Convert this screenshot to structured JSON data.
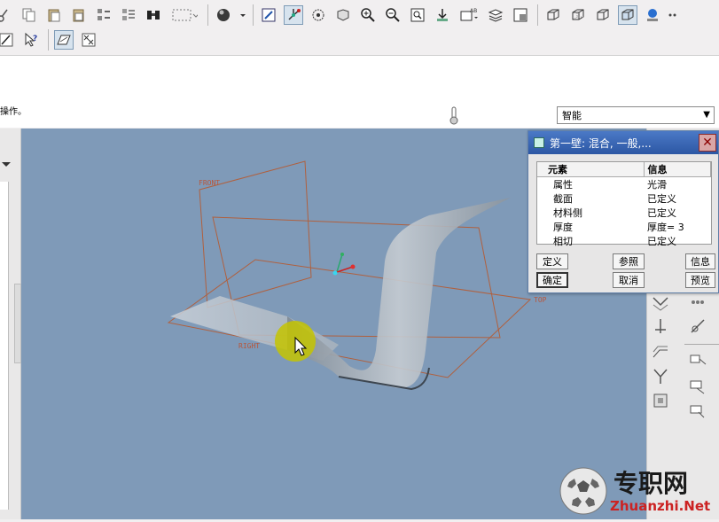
{
  "toolbar": {
    "row1": [
      "cut-icon",
      "copy-icon",
      "paste-icon",
      "paste-special-icon",
      "regenerate-icon",
      "regen-manager-icon",
      "find-icon",
      "select-box-icon",
      "shading-sphere-icon",
      "orient-icon",
      "spin-center-icon",
      "datum-display-icon",
      "redraw-icon",
      "zoom-in-icon",
      "zoom-out-icon",
      "refit-icon",
      "reorient-icon",
      "saved-views-icon",
      "layers-icon",
      "view-manager-icon",
      "wireframe-icon",
      "hidden-line-icon",
      "no-hidden-icon",
      "shaded-icon",
      "model-tree-icon",
      "more-icon"
    ],
    "row2": [
      "sketch-icon",
      "context-help-icon",
      "datum-plane-icon",
      "delete-datum-icon"
    ]
  },
  "status": {
    "message": "操作。"
  },
  "filter": {
    "selected": "智能"
  },
  "viewport": {
    "datum_labels": {
      "front": "FRONT",
      "top": "TOP",
      "right": "RIGHT"
    }
  },
  "dialog": {
    "title": "第一壁: 混合, 一般,...",
    "columns": [
      "元素",
      "信息"
    ],
    "rows": [
      {
        "element": "属性",
        "info": "光滑"
      },
      {
        "element": "截面",
        "info": "已定义"
      },
      {
        "element": "材料侧",
        "info": "已定义"
      },
      {
        "element": "厚度",
        "info": "厚度= 3"
      },
      {
        "element": "相切",
        "info": "已定义"
      }
    ],
    "buttons": {
      "define": "定义",
      "refs": "参照",
      "info": "信息",
      "ok": "确定",
      "cancel": "取消",
      "preview": "预览"
    }
  },
  "watermark": {
    "cn": "专职网",
    "en": "Zhuanzhi.Net"
  }
}
